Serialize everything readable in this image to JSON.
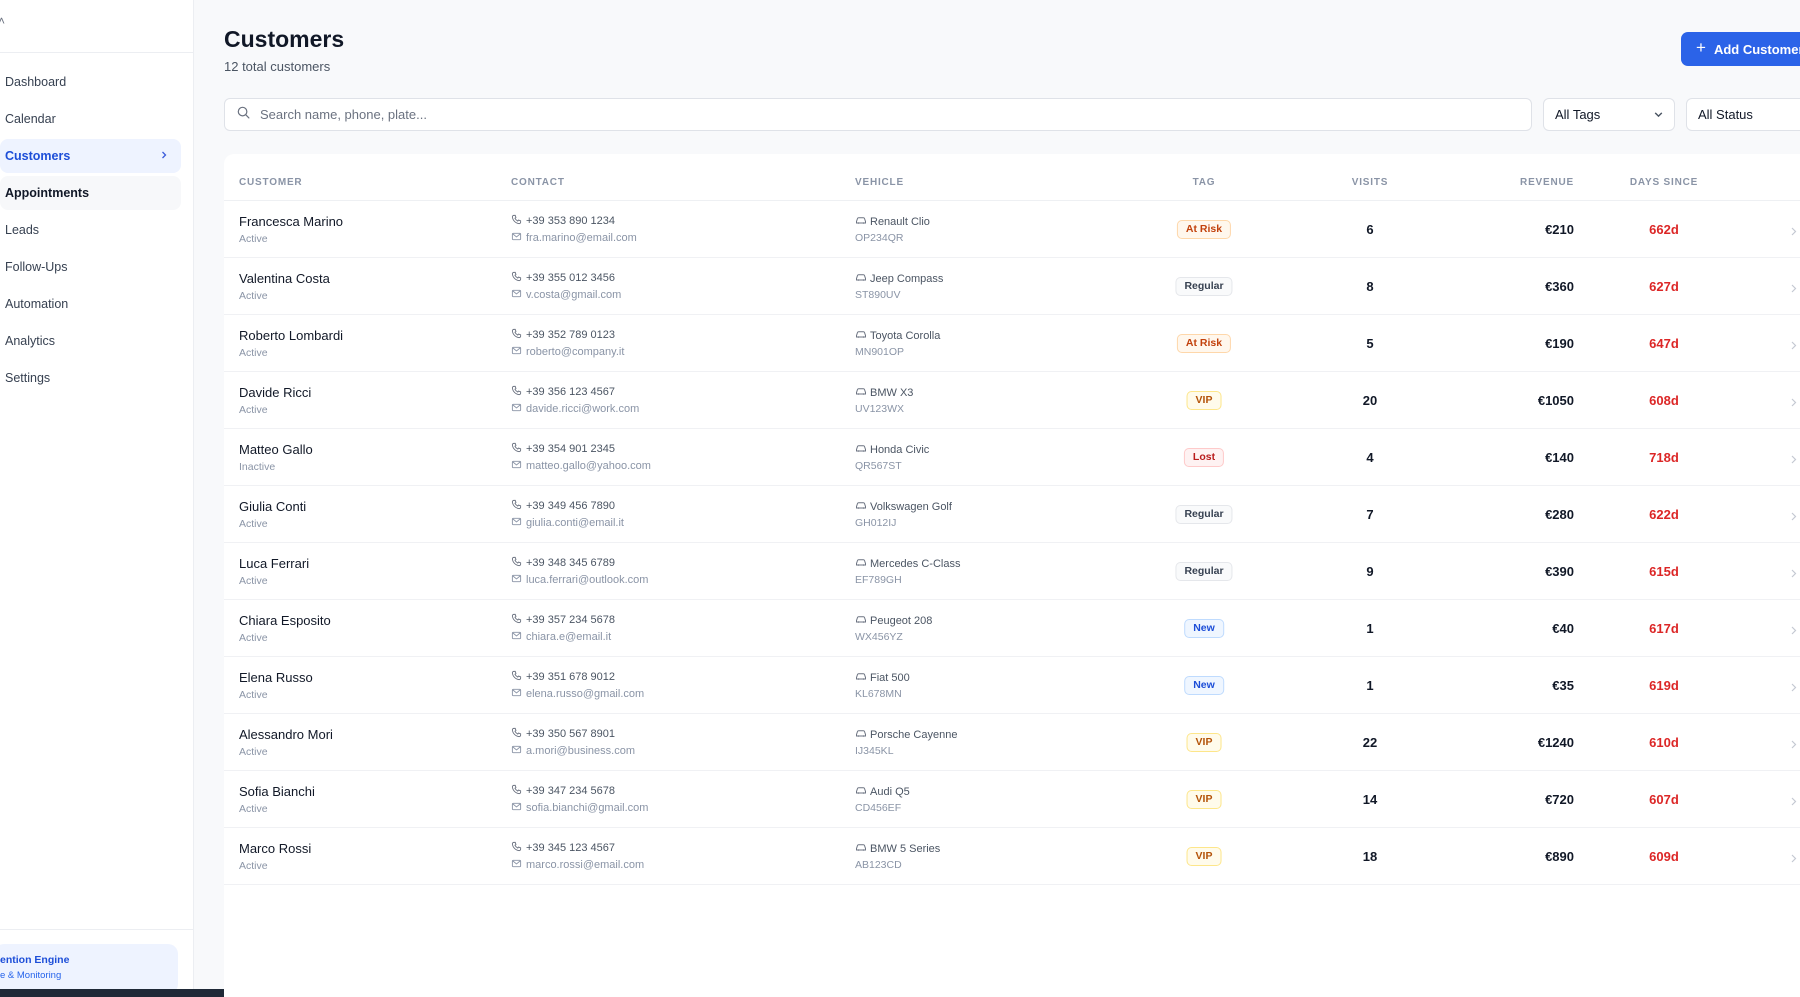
{
  "app": {
    "engine_title": "ention Engine",
    "engine_subtitle": "e & Monitoring"
  },
  "sidebar": {
    "items": [
      {
        "label": "Dashboard",
        "name": "sidebar-item-dashboard"
      },
      {
        "label": "Calendar",
        "name": "sidebar-item-calendar"
      },
      {
        "label": "Customers",
        "name": "sidebar-item-customers"
      },
      {
        "label": "Appointments",
        "name": "sidebar-item-appointments"
      },
      {
        "label": "Leads",
        "name": "sidebar-item-leads"
      },
      {
        "label": "Follow-Ups",
        "name": "sidebar-item-follow-ups"
      },
      {
        "label": "Automation",
        "name": "sidebar-item-automation"
      },
      {
        "label": "Analytics",
        "name": "sidebar-item-analytics"
      },
      {
        "label": "Settings",
        "name": "sidebar-item-settings"
      }
    ],
    "active": "Customers",
    "hovered": "Appointments"
  },
  "header": {
    "title": "Customers",
    "subtitle": "12 total customers",
    "add_button": "Add Customer"
  },
  "search": {
    "placeholder": "Search name, phone, plate...",
    "value": ""
  },
  "filters": {
    "tags": "All Tags",
    "status": "All Status"
  },
  "table": {
    "columns": [
      "CUSTOMER",
      "CONTACT",
      "VEHICLE",
      "TAG",
      "VISITS",
      "REVENUE",
      "DAYS SINCE"
    ],
    "rows": [
      {
        "name": "Francesca Marino",
        "status": "Active",
        "phone": "+39 353 890 1234",
        "email": "fra.marino@email.com",
        "vehicle": "Renault Clio",
        "plate": "OP234QR",
        "tag": "At Risk",
        "tag_class": "at-risk",
        "visits": "6",
        "revenue": "€210",
        "days": "662d"
      },
      {
        "name": "Valentina Costa",
        "status": "Active",
        "phone": "+39 355 012 3456",
        "email": "v.costa@gmail.com",
        "vehicle": "Jeep Compass",
        "plate": "ST890UV",
        "tag": "Regular",
        "tag_class": "regular",
        "visits": "8",
        "revenue": "€360",
        "days": "627d"
      },
      {
        "name": "Roberto Lombardi",
        "status": "Active",
        "phone": "+39 352 789 0123",
        "email": "roberto@company.it",
        "vehicle": "Toyota Corolla",
        "plate": "MN901OP",
        "tag": "At Risk",
        "tag_class": "at-risk",
        "visits": "5",
        "revenue": "€190",
        "days": "647d"
      },
      {
        "name": "Davide Ricci",
        "status": "Active",
        "phone": "+39 356 123 4567",
        "email": "davide.ricci@work.com",
        "vehicle": "BMW X3",
        "plate": "UV123WX",
        "tag": "VIP",
        "tag_class": "vip",
        "visits": "20",
        "revenue": "€1050",
        "days": "608d"
      },
      {
        "name": "Matteo Gallo",
        "status": "Inactive",
        "phone": "+39 354 901 2345",
        "email": "matteo.gallo@yahoo.com",
        "vehicle": "Honda Civic",
        "plate": "QR567ST",
        "tag": "Lost",
        "tag_class": "lost",
        "visits": "4",
        "revenue": "€140",
        "days": "718d"
      },
      {
        "name": "Giulia Conti",
        "status": "Active",
        "phone": "+39 349 456 7890",
        "email": "giulia.conti@email.it",
        "vehicle": "Volkswagen Golf",
        "plate": "GH012IJ",
        "tag": "Regular",
        "tag_class": "regular",
        "visits": "7",
        "revenue": "€280",
        "days": "622d"
      },
      {
        "name": "Luca Ferrari",
        "status": "Active",
        "phone": "+39 348 345 6789",
        "email": "luca.ferrari@outlook.com",
        "vehicle": "Mercedes C-Class",
        "plate": "EF789GH",
        "tag": "Regular",
        "tag_class": "regular",
        "visits": "9",
        "revenue": "€390",
        "days": "615d"
      },
      {
        "name": "Chiara Esposito",
        "status": "Active",
        "phone": "+39 357 234 5678",
        "email": "chiara.e@email.it",
        "vehicle": "Peugeot 208",
        "plate": "WX456YZ",
        "tag": "New",
        "tag_class": "new",
        "visits": "1",
        "revenue": "€40",
        "days": "617d"
      },
      {
        "name": "Elena Russo",
        "status": "Active",
        "phone": "+39 351 678 9012",
        "email": "elena.russo@gmail.com",
        "vehicle": "Fiat 500",
        "plate": "KL678MN",
        "tag": "New",
        "tag_class": "new",
        "visits": "1",
        "revenue": "€35",
        "days": "619d"
      },
      {
        "name": "Alessandro Mori",
        "status": "Active",
        "phone": "+39 350 567 8901",
        "email": "a.mori@business.com",
        "vehicle": "Porsche Cayenne",
        "plate": "IJ345KL",
        "tag": "VIP",
        "tag_class": "vip",
        "visits": "22",
        "revenue": "€1240",
        "days": "610d"
      },
      {
        "name": "Sofia Bianchi",
        "status": "Active",
        "phone": "+39 347 234 5678",
        "email": "sofia.bianchi@gmail.com",
        "vehicle": "Audi Q5",
        "plate": "CD456EF",
        "tag": "VIP",
        "tag_class": "vip",
        "visits": "14",
        "revenue": "€720",
        "days": "607d"
      },
      {
        "name": "Marco Rossi",
        "status": "Active",
        "phone": "+39 345 123 4567",
        "email": "marco.rossi@email.com",
        "vehicle": "BMW 5 Series",
        "plate": "AB123CD",
        "tag": "VIP",
        "tag_class": "vip",
        "visits": "18",
        "revenue": "€890",
        "days": "609d"
      }
    ]
  },
  "icons": {
    "search": "search-icon",
    "phone": "phone-icon",
    "mail": "mail-icon",
    "car": "car-icon",
    "chevron": "chevron-right-icon"
  },
  "colors": {
    "accent": "#2b63e8",
    "days_since": "#dc2626"
  }
}
